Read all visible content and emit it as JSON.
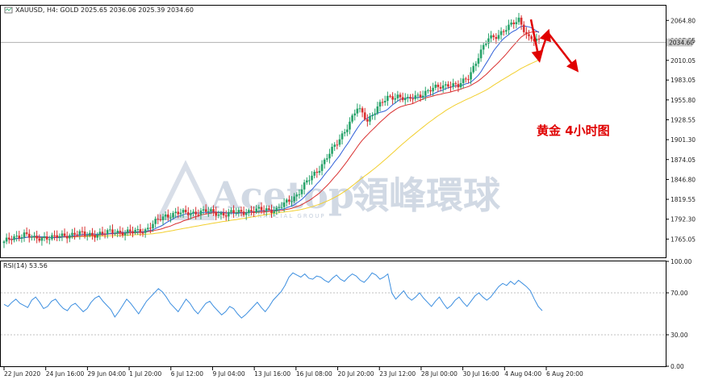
{
  "header": {
    "symbol_line": "XAUUSD, H4:  GOLD  2025.65 2036.06 2025.39 2034.60",
    "current_price": "2034.60"
  },
  "annotation": {
    "text": "黄金 4小时图"
  },
  "watermark": {
    "brand": "Acetop",
    "brand_cn": "領峰環球",
    "tagline": "ACETOP FINANCIAL GROUP"
  },
  "colors": {
    "bull": "#27a36a",
    "bear": "#d93030",
    "ma_fast": "#2f5fd8",
    "ma_mid": "#d93030",
    "ma_slow": "#f2cf2e",
    "rsi": "#3d8fe0",
    "arrow": "#e00000"
  },
  "rsi_panel": {
    "label": "RSI(14) 53.56"
  },
  "chart_data": [
    {
      "type": "candlestick",
      "title": "XAUUSD, H4:  GOLD  2025.65 2036.06 2025.39 2034.60",
      "ylim": [
        1740,
        2085
      ],
      "y_ticks": [
        "2064.80",
        "2037.55",
        "2010.05",
        "1983.05",
        "1955.80",
        "1928.55",
        "1901.30",
        "1874.05",
        "1846.80",
        "1819.55",
        "1792.30",
        "1765.05"
      ],
      "current_price_label": "2034.60",
      "x_ticks": [
        "22 Jun 2020",
        "24 Jun 16:00",
        "29 Jun 04:00",
        "1 Jul 20:00",
        "6 Jul 12:00",
        "9 Jul 04:00",
        "13 Jul 16:00",
        "16 Jul 08:00",
        "20 Jul 20:00",
        "23 Jul 12:00",
        "28 Jul 00:00",
        "30 Jul 16:00",
        "4 Aug 04:00",
        "6 Aug 20:00"
      ],
      "close_path_approx": [
        [
          0,
          1760
        ],
        [
          4,
          1768
        ],
        [
          8,
          1772
        ],
        [
          12,
          1765
        ],
        [
          16,
          1768
        ],
        [
          20,
          1767
        ],
        [
          24,
          1770
        ],
        [
          28,
          1773
        ],
        [
          32,
          1771
        ],
        [
          36,
          1772
        ],
        [
          40,
          1773
        ],
        [
          44,
          1776
        ],
        [
          48,
          1774
        ],
        [
          52,
          1775
        ],
        [
          56,
          1778
        ],
        [
          60,
          1788
        ],
        [
          64,
          1797
        ],
        [
          68,
          1801
        ],
        [
          72,
          1800
        ],
        [
          76,
          1802
        ],
        [
          80,
          1803
        ],
        [
          84,
          1801
        ],
        [
          88,
          1799
        ],
        [
          92,
          1802
        ],
        [
          96,
          1803
        ],
        [
          100,
          1804
        ],
        [
          104,
          1806
        ],
        [
          108,
          1805
        ],
        [
          112,
          1815
        ],
        [
          116,
          1826
        ],
        [
          120,
          1843
        ],
        [
          124,
          1858
        ],
        [
          128,
          1878
        ],
        [
          132,
          1896
        ],
        [
          136,
          1920
        ],
        [
          140,
          1944
        ],
        [
          144,
          1928
        ],
        [
          148,
          1946
        ],
        [
          152,
          1958
        ],
        [
          156,
          1962
        ],
        [
          160,
          1955
        ],
        [
          164,
          1962
        ],
        [
          168,
          1968
        ],
        [
          172,
          1973
        ],
        [
          176,
          1978
        ],
        [
          180,
          1974
        ],
        [
          184,
          1988
        ],
        [
          188,
          2015
        ],
        [
          192,
          2040
        ],
        [
          196,
          2046
        ],
        [
          200,
          2055
        ],
        [
          204,
          2067
        ],
        [
          208,
          2040
        ],
        [
          212,
          2035
        ]
      ],
      "forecast_arrows": [
        {
          "from": [
            2067,
            "6 Aug"
          ],
          "to": [
            2012,
            "6 Aug"
          ]
        },
        {
          "from": [
            2012,
            "6 Aug"
          ],
          "to": [
            2050,
            "7 Aug"
          ]
        },
        {
          "from": [
            2050,
            "7 Aug"
          ],
          "to": [
            1995,
            "8 Aug"
          ]
        }
      ]
    },
    {
      "type": "line",
      "title": "RSI(14) 53.56",
      "ylim": [
        0,
        100
      ],
      "y_ticks": [
        "100.00",
        "70.00",
        "30.00",
        "0.00"
      ],
      "levels": [
        70,
        30
      ],
      "values": [
        59,
        57,
        61,
        64,
        60,
        58,
        56,
        63,
        66,
        61,
        55,
        57,
        62,
        64,
        59,
        55,
        53,
        58,
        60,
        56,
        52,
        55,
        61,
        65,
        67,
        62,
        58,
        54,
        47,
        52,
        58,
        64,
        60,
        55,
        50,
        56,
        62,
        66,
        70,
        74,
        71,
        66,
        60,
        56,
        52,
        58,
        64,
        60,
        54,
        50,
        55,
        60,
        62,
        57,
        53,
        49,
        52,
        57,
        55,
        50,
        46,
        49,
        53,
        57,
        61,
        56,
        52,
        57,
        63,
        67,
        71,
        77,
        85,
        89,
        87,
        85,
        88,
        84,
        83,
        86,
        85,
        82,
        80,
        84,
        87,
        83,
        81,
        85,
        88,
        86,
        82,
        80,
        84,
        89,
        87,
        83,
        85,
        88,
        70,
        64,
        68,
        72,
        66,
        63,
        66,
        70,
        65,
        61,
        57,
        62,
        66,
        60,
        55,
        58,
        63,
        66,
        61,
        57,
        62,
        67,
        70,
        66,
        63,
        66,
        71,
        76,
        79,
        77,
        81,
        78,
        82,
        79,
        76,
        72,
        64,
        57,
        53
      ]
    }
  ]
}
